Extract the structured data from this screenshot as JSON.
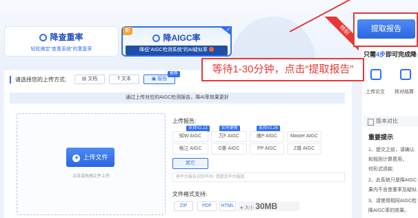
{
  "cards": {
    "dedup": {
      "title": "降查重率",
      "subtitle": "轻松搞定\"查重系统\"的重复率"
    },
    "aigc": {
      "title": "降AIGC率",
      "subtitle": "降低\"AIGC检测系统\"的AI疑似率",
      "new_tag": "新"
    }
  },
  "ribbon": "特别",
  "extract_button": "提取报告",
  "annotation": "等待1-30分钟，点击“提取报告”",
  "right_panel": {
    "steps_prefix": "只需",
    "steps_num": "4步",
    "steps_suffix": "即可完成降",
    "step1": "上传论文",
    "step2": "核对结算",
    "version": "版本对比",
    "notice_title": "重要提示",
    "notice_lines": [
      "1、提交之前，请确认",
      "和规则计算费用，",
      "何形式退款;",
      "2、此系统只是降AIGC",
      "果内不含查重率及疑似",
      "3、请使用相同AIGC检",
      "降AIGC率的效果。"
    ]
  },
  "upload_section": {
    "label": "请选择您的上传方式:",
    "tabs": [
      "文档",
      "文本",
      "报告"
    ],
    "recommend_tag": "推荐",
    "info": "通过上传对应的AIGC检测报告，降AI率效果更好",
    "upload_button": "上传文件",
    "upload_hint": "点击或拖拽文件上传"
  },
  "report": {
    "label": "上传报告:",
    "badges": [
      "支持V2.13",
      "实时更新",
      "支持V2.26"
    ],
    "row1": [
      "知W AIGC",
      "万F AIGC",
      "维P AIGC",
      "Master AIGC"
    ],
    "row2": [
      "格江 AIGC",
      "D普 AIGC",
      "PP AIGC",
      "Z普 AIGC"
    ],
    "other": "其它",
    "input_placeholder": "将平台报告识别不同, 请提交平台链接"
  },
  "formats": {
    "label": "文件格式支持:",
    "items": [
      "ZIP",
      "PDF",
      "HTML"
    ],
    "size_label": "大小",
    "size_value": "30MB"
  }
}
